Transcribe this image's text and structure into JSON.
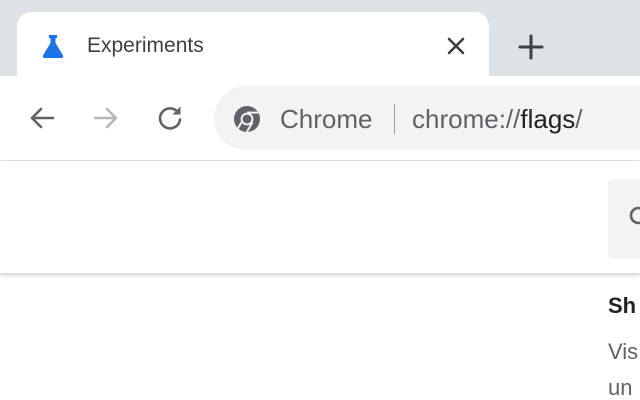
{
  "tab": {
    "title": "Experiments",
    "favicon": "flask-icon",
    "favicon_color": "#1a73e8",
    "close_icon": "close-icon",
    "new_tab_icon": "plus-icon"
  },
  "toolbar": {
    "back_icon": "back-arrow-icon",
    "forward_icon": "forward-arrow-icon",
    "reload_icon": "reload-icon",
    "forward_enabled": false
  },
  "omnibox": {
    "chip_icon": "chrome-logo-icon",
    "chip_label": "Chrome",
    "url_scheme": "chrome://",
    "url_host": "flags",
    "url_suffix": "/"
  },
  "page": {
    "search_icon": "search-icon",
    "flag_title_partial": "Sh",
    "flag_desc_lines": [
      "Vis",
      "un"
    ]
  },
  "colors": {
    "tab_strip": "#dee1e6",
    "omnibox_bg": "#f1f3f4",
    "accent": "#1a73e8",
    "text_primary": "#202124",
    "text_secondary": "#5f6368"
  }
}
